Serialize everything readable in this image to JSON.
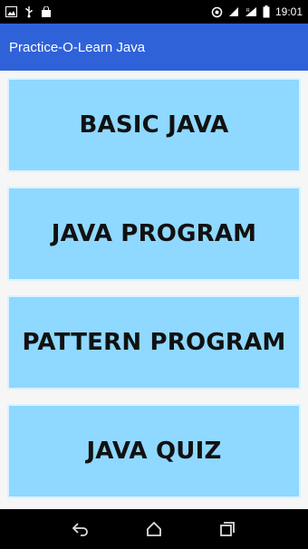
{
  "status_bar": {
    "time": "19:01",
    "icons": [
      "image-icon",
      "usb-icon",
      "shopping-bag-icon",
      "sync-icon",
      "no-sim-icon",
      "signal-icon",
      "battery-icon"
    ]
  },
  "app_bar": {
    "title": "Practice-O-Learn Java"
  },
  "menu": {
    "items": [
      {
        "label": "BASIC JAVA"
      },
      {
        "label": "JAVA PROGRAM"
      },
      {
        "label": "PATTERN PROGRAM"
      },
      {
        "label": "JAVA QUIZ"
      }
    ]
  },
  "nav_bar": {
    "icons": [
      "back-icon",
      "home-icon",
      "recents-icon"
    ]
  },
  "colors": {
    "status_bar": "#000000",
    "app_bar": "#2f62d9",
    "menu_item": "#8fd8ff",
    "nav_bar": "#000000"
  }
}
